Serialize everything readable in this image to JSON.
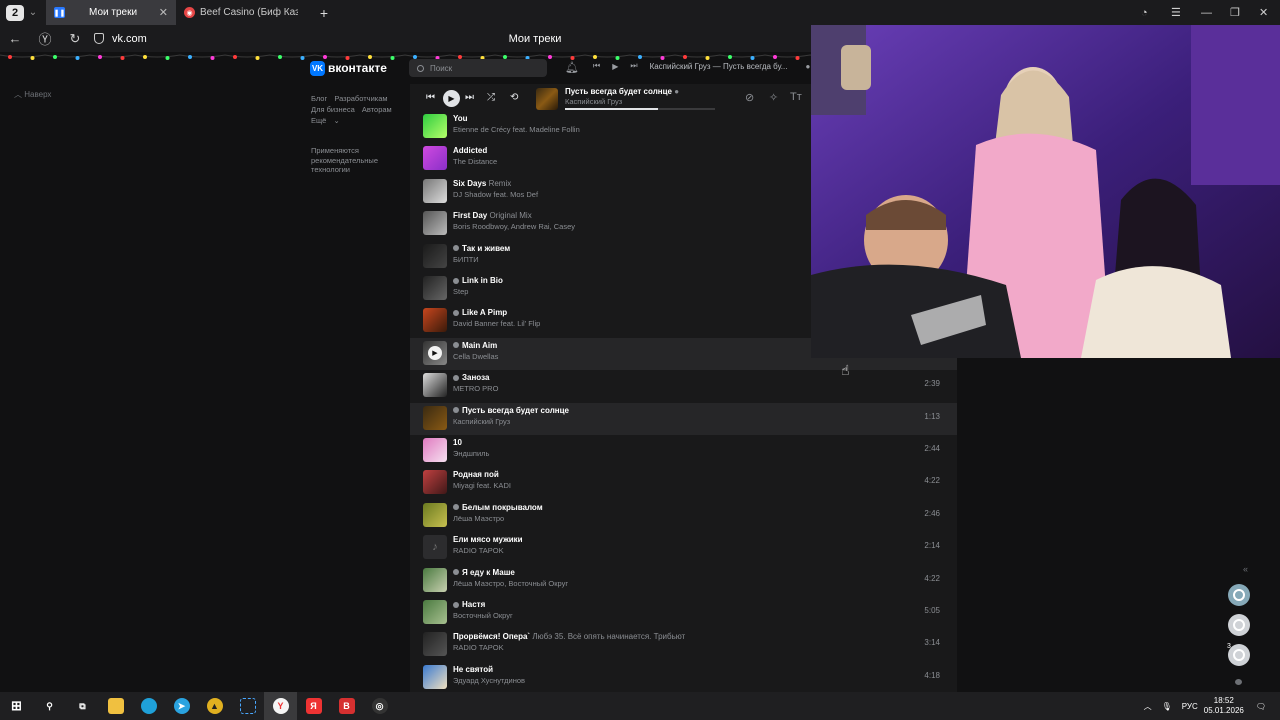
{
  "browser": {
    "tab_counter": "2",
    "tabs": [
      {
        "title": "Мои треки",
        "active": true
      },
      {
        "title": "Beef Casino (Биф Казино)",
        "active": false
      }
    ],
    "url": "vk.com",
    "page_title": "Мои треки"
  },
  "vk": {
    "logo_text": "вконтакте",
    "search_placeholder": "Поиск",
    "mini_player_title": "Каспийский Груз — Пусть всегда бу...",
    "back_to_top": "Наверх",
    "footer_links_row1": [
      "Блог",
      "Разработчикам"
    ],
    "footer_links_row2": [
      "Для бизнеса",
      "Авторам"
    ],
    "footer_more": "Ещё",
    "footer_note": "Применяются рекомендательные технологии",
    "player": {
      "title": "Пусть всегда будет солнце",
      "artist": "Каспийский Груз",
      "progress": 0.62
    },
    "tracks": [
      {
        "title": "You",
        "subtitle": "",
        "artist": "Etienne de Crécy feat. Madeline Follin",
        "duration": "",
        "explicit": false
      },
      {
        "title": "Addicted",
        "subtitle": "",
        "artist": "The Distance",
        "duration": "",
        "explicit": false
      },
      {
        "title": "Six Days",
        "subtitle": "Remix",
        "artist": "DJ Shadow feat. Mos Def",
        "duration": "",
        "explicit": false
      },
      {
        "title": "First Day",
        "subtitle": "Original Mix",
        "artist": "Boris Roodbwoy, Andrew Rai, Casey",
        "duration": "",
        "explicit": false
      },
      {
        "title": "Так и живем",
        "subtitle": "",
        "artist": "БИПТИ",
        "duration": "",
        "explicit": true
      },
      {
        "title": "Link in Bio",
        "subtitle": "",
        "artist": "Step",
        "duration": "",
        "explicit": true
      },
      {
        "title": "Like A Pimp",
        "subtitle": "",
        "artist": "David Banner feat. Lil' Flip",
        "duration": "",
        "explicit": true
      },
      {
        "title": "Main Aim",
        "subtitle": "",
        "artist": "Cella Dwellas",
        "duration": "",
        "explicit": true
      },
      {
        "title": "Заноза",
        "subtitle": "",
        "artist": "METRO PRO",
        "duration": "2:39",
        "explicit": true
      },
      {
        "title": "Пусть всегда будет солнце",
        "subtitle": "",
        "artist": "Каспийский Груз",
        "duration": "1:13",
        "explicit": true
      },
      {
        "title": "10",
        "subtitle": "",
        "artist": "Эндшпиль",
        "duration": "2:44",
        "explicit": false
      },
      {
        "title": "Родная пой",
        "subtitle": "",
        "artist": "Miyagi feat. KADI",
        "duration": "4:22",
        "explicit": false
      },
      {
        "title": "Белым покрывалом",
        "subtitle": "",
        "artist": "Лёша Маэстро",
        "duration": "2:46",
        "explicit": true
      },
      {
        "title": "Ели мясо мужики",
        "subtitle": "",
        "artist": "RADIO TAPOK",
        "duration": "2:14",
        "explicit": false
      },
      {
        "title": "Я еду к Маше",
        "subtitle": "",
        "artist": "Лёша Маэстро, Восточный Округ",
        "duration": "4:22",
        "explicit": true
      },
      {
        "title": "Настя",
        "subtitle": "",
        "artist": "Восточный Округ",
        "duration": "5:05",
        "explicit": true
      },
      {
        "title": "Прорвёмся! Опера`",
        "subtitle": "Любэ 35. Всё опять начинается. Трибьют",
        "artist": "RADIO TAPOK",
        "duration": "3:14",
        "explicit": false
      },
      {
        "title": "Не святой",
        "subtitle": "",
        "artist": "Эдуард Хуснутдинов",
        "duration": "4:18",
        "explicit": false
      }
    ],
    "rail_badge": "3"
  },
  "taskbar": {
    "lang": "РУС",
    "time": "18:52",
    "date": "05.01.2026"
  },
  "colors": {
    "vk_blue": "#0077ff",
    "bg": "#19191a"
  }
}
